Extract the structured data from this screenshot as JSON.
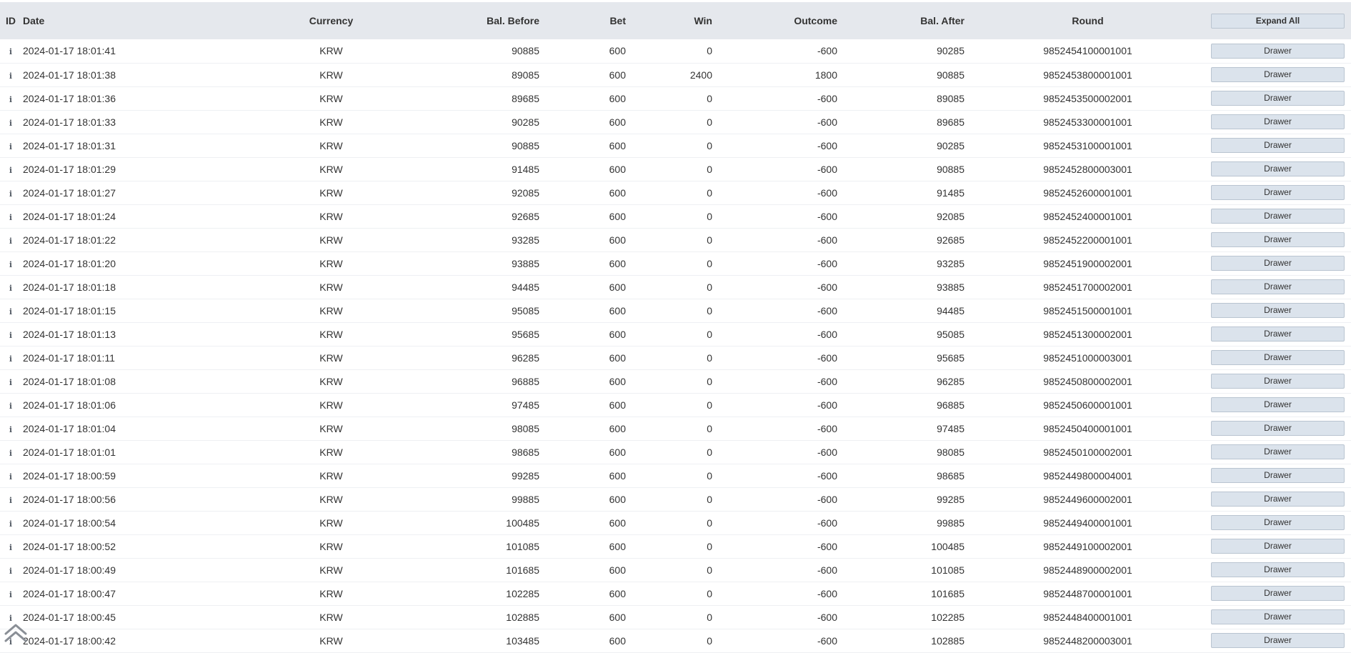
{
  "columns": {
    "id": "ID",
    "date": "Date",
    "currency": "Currency",
    "bal_before": "Bal. Before",
    "bet": "Bet",
    "win": "Win",
    "outcome": "Outcome",
    "bal_after": "Bal. After",
    "round": "Round"
  },
  "expand_all_label": "Expand All",
  "drawer_label": "Drawer",
  "icons": {
    "row_info": "info-icon",
    "scroll_top": "double-chevron-up-icon"
  },
  "rows": [
    {
      "date": "2024-01-17 18:01:41",
      "currency": "KRW",
      "bal_before": "90885",
      "bet": "600",
      "win": "0",
      "outcome": "-600",
      "bal_after": "90285",
      "round": "9852454100001001"
    },
    {
      "date": "2024-01-17 18:01:38",
      "currency": "KRW",
      "bal_before": "89085",
      "bet": "600",
      "win": "2400",
      "outcome": "1800",
      "bal_after": "90885",
      "round": "9852453800001001"
    },
    {
      "date": "2024-01-17 18:01:36",
      "currency": "KRW",
      "bal_before": "89685",
      "bet": "600",
      "win": "0",
      "outcome": "-600",
      "bal_after": "89085",
      "round": "9852453500002001"
    },
    {
      "date": "2024-01-17 18:01:33",
      "currency": "KRW",
      "bal_before": "90285",
      "bet": "600",
      "win": "0",
      "outcome": "-600",
      "bal_after": "89685",
      "round": "9852453300001001"
    },
    {
      "date": "2024-01-17 18:01:31",
      "currency": "KRW",
      "bal_before": "90885",
      "bet": "600",
      "win": "0",
      "outcome": "-600",
      "bal_after": "90285",
      "round": "9852453100001001"
    },
    {
      "date": "2024-01-17 18:01:29",
      "currency": "KRW",
      "bal_before": "91485",
      "bet": "600",
      "win": "0",
      "outcome": "-600",
      "bal_after": "90885",
      "round": "9852452800003001"
    },
    {
      "date": "2024-01-17 18:01:27",
      "currency": "KRW",
      "bal_before": "92085",
      "bet": "600",
      "win": "0",
      "outcome": "-600",
      "bal_after": "91485",
      "round": "9852452600001001"
    },
    {
      "date": "2024-01-17 18:01:24",
      "currency": "KRW",
      "bal_before": "92685",
      "bet": "600",
      "win": "0",
      "outcome": "-600",
      "bal_after": "92085",
      "round": "9852452400001001"
    },
    {
      "date": "2024-01-17 18:01:22",
      "currency": "KRW",
      "bal_before": "93285",
      "bet": "600",
      "win": "0",
      "outcome": "-600",
      "bal_after": "92685",
      "round": "9852452200001001"
    },
    {
      "date": "2024-01-17 18:01:20",
      "currency": "KRW",
      "bal_before": "93885",
      "bet": "600",
      "win": "0",
      "outcome": "-600",
      "bal_after": "93285",
      "round": "9852451900002001"
    },
    {
      "date": "2024-01-17 18:01:18",
      "currency": "KRW",
      "bal_before": "94485",
      "bet": "600",
      "win": "0",
      "outcome": "-600",
      "bal_after": "93885",
      "round": "9852451700002001"
    },
    {
      "date": "2024-01-17 18:01:15",
      "currency": "KRW",
      "bal_before": "95085",
      "bet": "600",
      "win": "0",
      "outcome": "-600",
      "bal_after": "94485",
      "round": "9852451500001001"
    },
    {
      "date": "2024-01-17 18:01:13",
      "currency": "KRW",
      "bal_before": "95685",
      "bet": "600",
      "win": "0",
      "outcome": "-600",
      "bal_after": "95085",
      "round": "9852451300002001"
    },
    {
      "date": "2024-01-17 18:01:11",
      "currency": "KRW",
      "bal_before": "96285",
      "bet": "600",
      "win": "0",
      "outcome": "-600",
      "bal_after": "95685",
      "round": "9852451000003001"
    },
    {
      "date": "2024-01-17 18:01:08",
      "currency": "KRW",
      "bal_before": "96885",
      "bet": "600",
      "win": "0",
      "outcome": "-600",
      "bal_after": "96285",
      "round": "9852450800002001"
    },
    {
      "date": "2024-01-17 18:01:06",
      "currency": "KRW",
      "bal_before": "97485",
      "bet": "600",
      "win": "0",
      "outcome": "-600",
      "bal_after": "96885",
      "round": "9852450600001001"
    },
    {
      "date": "2024-01-17 18:01:04",
      "currency": "KRW",
      "bal_before": "98085",
      "bet": "600",
      "win": "0",
      "outcome": "-600",
      "bal_after": "97485",
      "round": "9852450400001001"
    },
    {
      "date": "2024-01-17 18:01:01",
      "currency": "KRW",
      "bal_before": "98685",
      "bet": "600",
      "win": "0",
      "outcome": "-600",
      "bal_after": "98085",
      "round": "9852450100002001"
    },
    {
      "date": "2024-01-17 18:00:59",
      "currency": "KRW",
      "bal_before": "99285",
      "bet": "600",
      "win": "0",
      "outcome": "-600",
      "bal_after": "98685",
      "round": "9852449800004001"
    },
    {
      "date": "2024-01-17 18:00:56",
      "currency": "KRW",
      "bal_before": "99885",
      "bet": "600",
      "win": "0",
      "outcome": "-600",
      "bal_after": "99285",
      "round": "9852449600002001"
    },
    {
      "date": "2024-01-17 18:00:54",
      "currency": "KRW",
      "bal_before": "100485",
      "bet": "600",
      "win": "0",
      "outcome": "-600",
      "bal_after": "99885",
      "round": "9852449400001001"
    },
    {
      "date": "2024-01-17 18:00:52",
      "currency": "KRW",
      "bal_before": "101085",
      "bet": "600",
      "win": "0",
      "outcome": "-600",
      "bal_after": "100485",
      "round": "9852449100002001"
    },
    {
      "date": "2024-01-17 18:00:49",
      "currency": "KRW",
      "bal_before": "101685",
      "bet": "600",
      "win": "0",
      "outcome": "-600",
      "bal_after": "101085",
      "round": "9852448900002001"
    },
    {
      "date": "2024-01-17 18:00:47",
      "currency": "KRW",
      "bal_before": "102285",
      "bet": "600",
      "win": "0",
      "outcome": "-600",
      "bal_after": "101685",
      "round": "9852448700001001"
    },
    {
      "date": "2024-01-17 18:00:45",
      "currency": "KRW",
      "bal_before": "102885",
      "bet": "600",
      "win": "0",
      "outcome": "-600",
      "bal_after": "102285",
      "round": "9852448400001001"
    },
    {
      "date": "2024-01-17 18:00:42",
      "currency": "KRW",
      "bal_before": "103485",
      "bet": "600",
      "win": "0",
      "outcome": "-600",
      "bal_after": "102885",
      "round": "9852448200003001"
    }
  ]
}
